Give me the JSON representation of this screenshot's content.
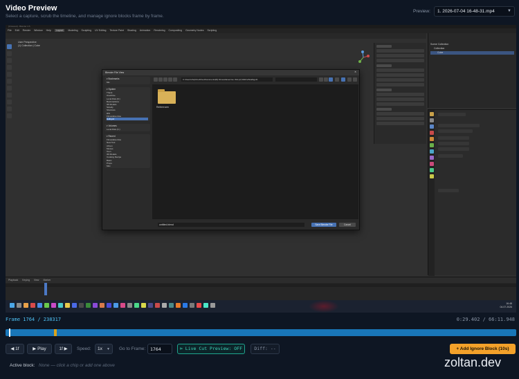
{
  "header": {
    "title": "Video Preview",
    "subtitle": "Select a capture, scrub the timeline, and manage ignore blocks frame by frame.",
    "preview_label": "Preview:",
    "preview_selected": "1. 2026-07-04 16-48-31.mp4"
  },
  "screenshot": {
    "window_title": "[Unsaved] - Blender 4.5",
    "menu_items": [
      "File",
      "Edit",
      "Render",
      "Window",
      "Help",
      "Layout",
      "Modeling",
      "Sculpting",
      "UV Editing",
      "Texture Paint",
      "Shading",
      "Animation",
      "Rendering",
      "Compositing",
      "Geometry Nodes",
      "Scripting"
    ],
    "viewport_text": [
      "User Perspective",
      "(1) Collection | Cube"
    ],
    "outliner_items": [
      "Scene Collection",
      "Collection",
      "Cube"
    ],
    "dialog": {
      "title": "Blender File View",
      "path": "C:\\Users\\zhq\\OneDrive\\Documents\\[5] Fitness\\Exercise Vids [2] Wiki\\ref\\Halbgott\\",
      "sections": [
        {
          "heading": "Bookmarks",
          "items": [
            "Mix"
          ]
        },
        {
          "heading": "System",
          "items": [
            "Thank",
            "OneDrive",
            "Local Disk (D:)",
            "BookmarksLs",
            "3D Models",
            "Sintelly",
            "Shortcuts",
            "RIS",
            "FitnessExercise",
            "Halbgott"
          ]
        },
        {
          "heading": "Volumes",
          "items": [
            "Local Disk (C:)"
          ]
        },
        {
          "heading": "Recent",
          "items": [
            "FitnessExercise",
            "New Tool",
            "Ahnen",
            "Movies",
            "Toon",
            "3D Models",
            "Cooking Recipe",
            "Basic",
            "Props",
            "Mist"
          ]
        }
      ],
      "folder_name": "Referenzen",
      "filename": "untitled.blend",
      "ok_label": "Save Blender File",
      "cancel_label": "Cancel"
    },
    "timeline_controls": [
      "Playback",
      "Keying",
      "View",
      "Marker"
    ],
    "clock": [
      "16:48",
      "04.07.2026"
    ]
  },
  "status": {
    "frame_text": "Frame 1764 / 238317",
    "time_text": "0:29.402 / 66:11.948",
    "progress": 0.0074,
    "ignore_marker": 0.095
  },
  "controls": {
    "back": "◀ 1f",
    "play": "▶ Play",
    "forward": "1f ▶",
    "speed_label": "Speed:",
    "speed_value": "1x",
    "goto_label": "Go to Frame:",
    "goto_value": "1764",
    "live_cut": "⊳ Live Cut Preview: OFF",
    "diff": "Diff: --",
    "add_ignore": "+ Add Ignore Block (10s)"
  },
  "active_block": {
    "label": "Active block:",
    "value": "None — click a chip or add one above"
  },
  "watermark": "zoltan.dev",
  "colors": {
    "background": "#0e1623",
    "accent_frame": "#4fc3f7",
    "scrub": "#1976b8",
    "ignore_marker": "#d9a21b",
    "live_cut": "#3fd6ba",
    "add_button": "#f3a12a"
  }
}
